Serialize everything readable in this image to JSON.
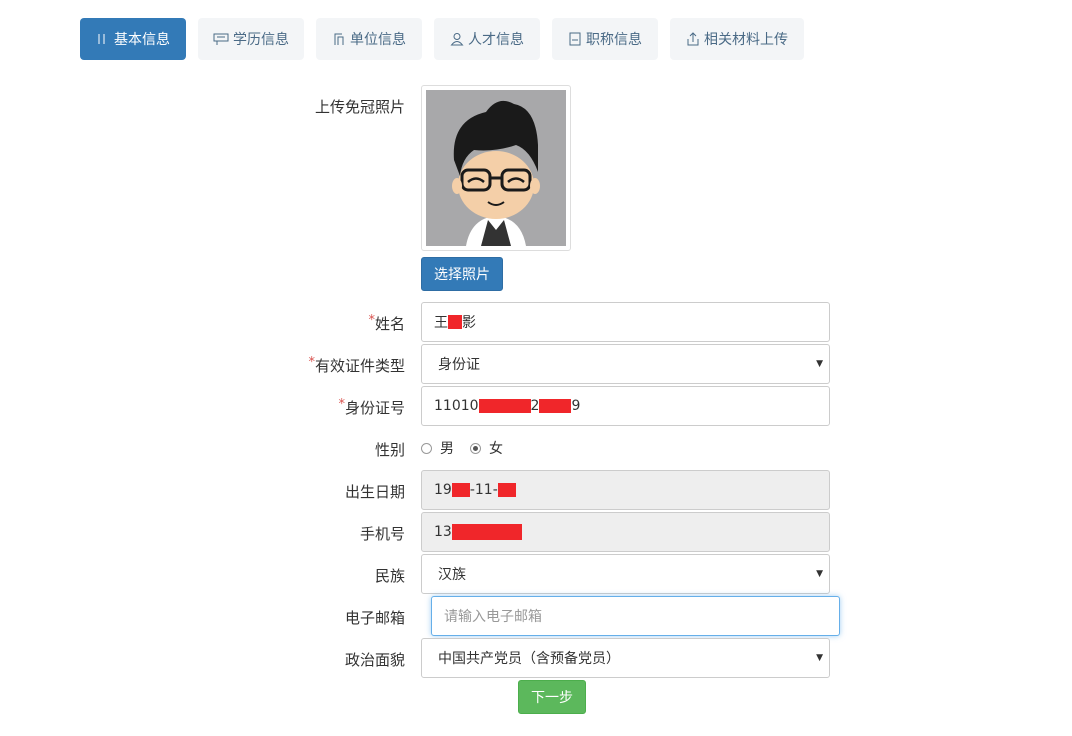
{
  "tabs": [
    {
      "label": "基本信息",
      "icon": "id-card-icon",
      "active": true
    },
    {
      "label": "学历信息",
      "icon": "graduation-icon",
      "active": false
    },
    {
      "label": "单位信息",
      "icon": "building-icon",
      "active": false
    },
    {
      "label": "人才信息",
      "icon": "person-icon",
      "active": false
    },
    {
      "label": "职称信息",
      "icon": "document-icon",
      "active": false
    },
    {
      "label": "相关材料上传",
      "icon": "upload-icon",
      "active": false
    }
  ],
  "photo": {
    "label": "上传免冠照片",
    "button": "选择照片"
  },
  "form": {
    "name": {
      "label": "姓名",
      "required": "*",
      "value_prefix": "王",
      "value_suffix": "影"
    },
    "id_type": {
      "label": "有效证件类型",
      "required": "*",
      "value": "身份证"
    },
    "id_number": {
      "label": "身份证号",
      "required": "*",
      "value_prefix": "11010",
      "value_mid": "2",
      "value_suffix": "9"
    },
    "gender": {
      "label": "性别",
      "options": [
        "男",
        "女"
      ],
      "selected": "女"
    },
    "birth": {
      "label": "出生日期",
      "value_prefix": "19",
      "value_mid": "-11-"
    },
    "phone": {
      "label": "手机号",
      "value_prefix": "13"
    },
    "ethnicity": {
      "label": "民族",
      "value": "汉族"
    },
    "email": {
      "label": "电子邮箱",
      "placeholder": "请输入电子邮箱"
    },
    "political": {
      "label": "政治面貌",
      "value": "中国共产党员（含预备党员）"
    }
  },
  "next_button": "下一步",
  "colors": {
    "primary": "#337ab7",
    "success": "#5cb85c",
    "required": "#d9534f",
    "redaction": "#f0262a"
  }
}
